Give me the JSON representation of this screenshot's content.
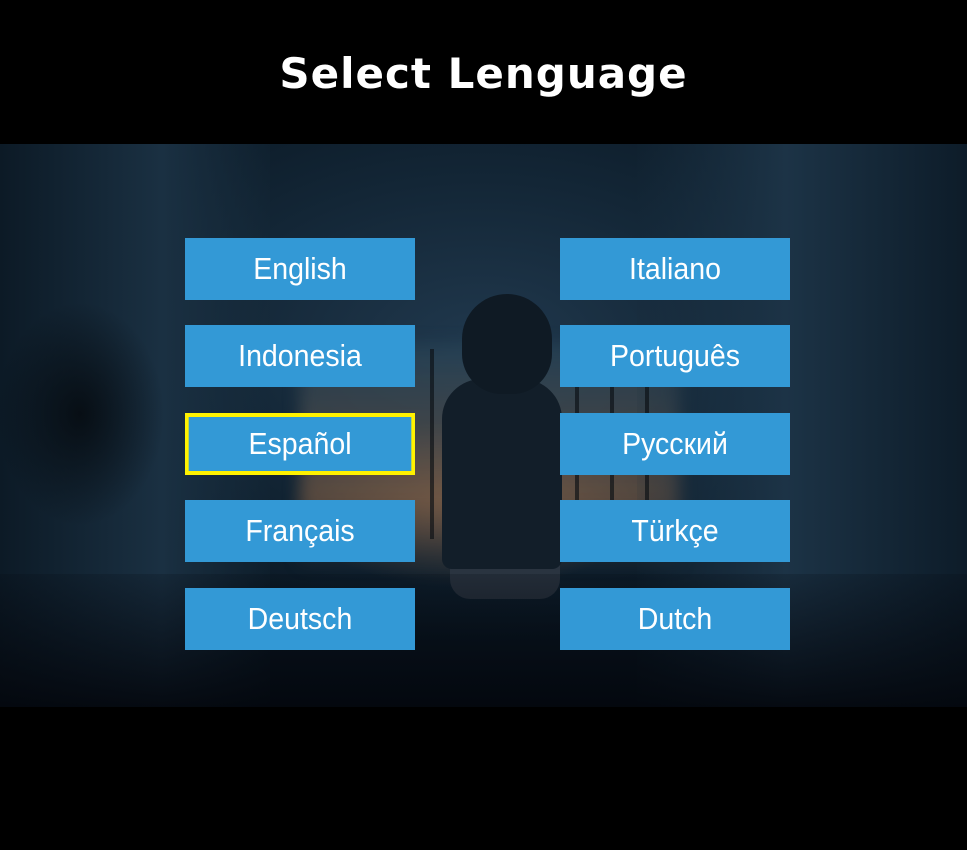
{
  "title": "Select Lenguage",
  "colors": {
    "button_bg": "#3399d6",
    "button_text": "#ffffff",
    "selection_outline": "#fff200",
    "title_text": "#ffffff"
  },
  "selected_language": "Español",
  "languages": {
    "left": [
      "English",
      "Indonesia",
      "Español",
      "Français",
      "Deutsch"
    ],
    "right": [
      "Italiano",
      "Português",
      "Русский",
      "Türkçe",
      "Dutch"
    ]
  }
}
